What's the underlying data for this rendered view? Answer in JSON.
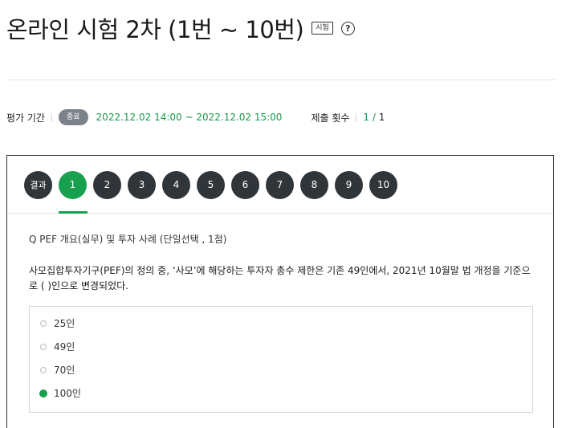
{
  "header": {
    "title": "온라인 시험 2차 (1번 ~ 10번)",
    "tag": "시험",
    "help_icon": "question-circle-icon"
  },
  "meta": {
    "period_label": "평가 기간",
    "status_badge": "종료",
    "period_value": "2022.12.02 14:00 ~ 2022.12.02 15:00",
    "submit_label": "제출 횟수",
    "submit_value": "1 / 1"
  },
  "nav": {
    "result_label": "결과",
    "questions": [
      "1",
      "2",
      "3",
      "4",
      "5",
      "6",
      "7",
      "8",
      "9",
      "10"
    ],
    "active": "1"
  },
  "question": {
    "label": "Q  PEF 개요(실무) 및 투자 사례 (단일선택 , 1점)",
    "text": "사모집합투자기구(PEF)의 정의 중, ‘사모’에 해당하는 투자자 총수 제한은 기존 49인에서, 2021년 10월말 법 개정을 기준으로 (      )인으로 변경되었다.",
    "options": [
      "25인",
      "49인",
      "70인",
      "100인"
    ],
    "selected_index": 3
  },
  "colors": {
    "accent_green": "#17a04e",
    "nav_dark": "#30353a",
    "badge_gray": "#7c8289"
  }
}
